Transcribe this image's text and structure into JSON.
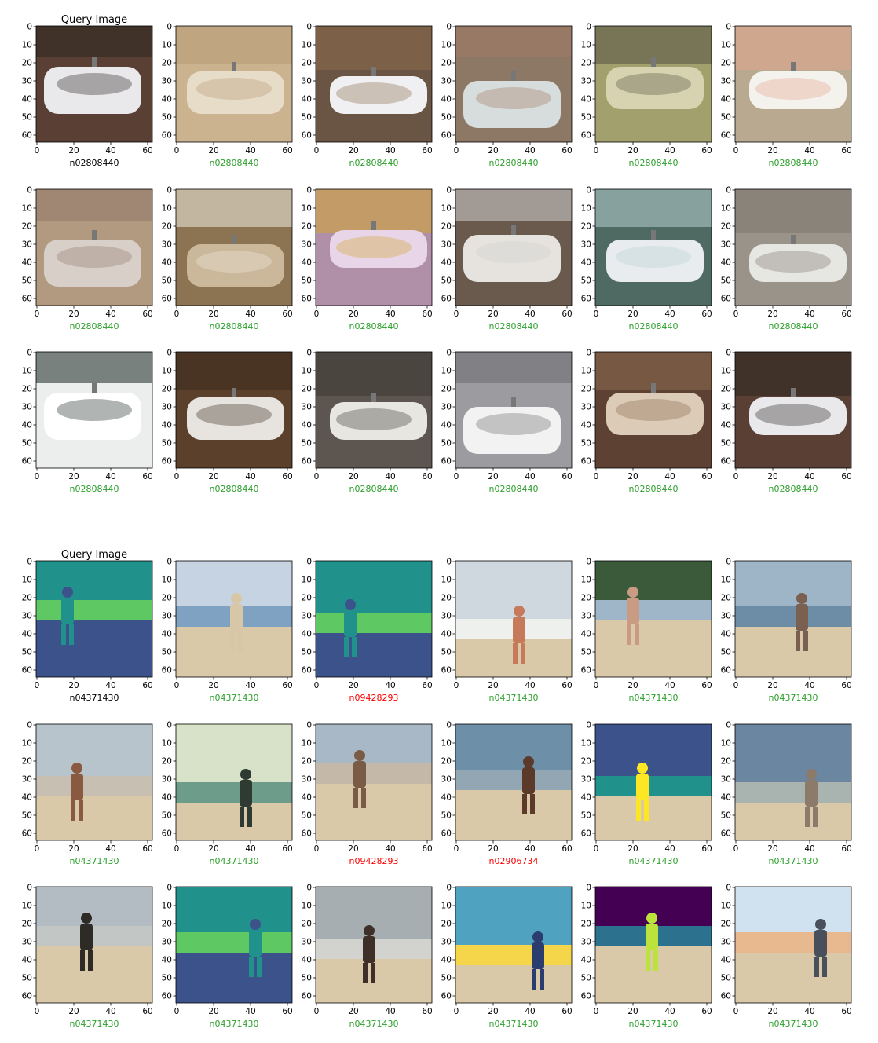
{
  "figure": {
    "query_title": "Query Image",
    "axis_ticks": [
      "0",
      "10",
      "20",
      "30",
      "40",
      "50",
      "60"
    ],
    "x_ticks": [
      "0",
      "20",
      "40",
      "60"
    ],
    "colors": {
      "query": "#000000",
      "correct": "#2ca02c",
      "wrong": "#ff0000"
    }
  },
  "chart_data": [
    {
      "type": "table",
      "title": "Query Image",
      "query_label": "n02808440",
      "scene": "bathtub",
      "xlim": [
        0,
        63
      ],
      "ylim": [
        63,
        0
      ],
      "results": [
        [
          "n02808440",
          "correct",
          "tub-beige"
        ],
        [
          "n02808440",
          "correct",
          "tub-white"
        ],
        [
          "n02808440",
          "correct",
          "tub-person"
        ],
        [
          "n02808440",
          "correct",
          "tub-olive"
        ],
        [
          "n02808440",
          "correct",
          "tub-legs"
        ],
        [
          "n02808440",
          "correct",
          "tub-tile"
        ],
        [
          "n02808440",
          "correct",
          "tub-corner"
        ],
        [
          "n02808440",
          "correct",
          "tub-gold"
        ],
        [
          "n02808440",
          "correct",
          "tub-clawfoot"
        ],
        [
          "n02808440",
          "correct",
          "tub-window"
        ],
        [
          "n02808440",
          "correct",
          "tub-grey"
        ],
        [
          "n02808440",
          "correct",
          "tub-product"
        ],
        [
          "n02808440",
          "correct",
          "tub-wood"
        ],
        [
          "n02808440",
          "correct",
          "tub-stone"
        ],
        [
          "n02808440",
          "correct",
          "tub-blue-wall"
        ],
        [
          "n02808440",
          "correct",
          "tub-faucet"
        ],
        [
          "n02808440",
          "correct",
          "tub-brown"
        ]
      ]
    },
    {
      "type": "table",
      "title": "Query Image",
      "query_label": "n04371430",
      "scene": "beach",
      "xlim": [
        0,
        63
      ],
      "ylim": [
        63,
        0
      ],
      "results": [
        [
          "n04371430",
          "correct",
          "sunset"
        ],
        [
          "n09428293",
          "wrong",
          "viridis-run"
        ],
        [
          "n04371430",
          "correct",
          "jump"
        ],
        [
          "n04371430",
          "correct",
          "sand-beach"
        ],
        [
          "n04371430",
          "correct",
          "night"
        ],
        [
          "n04371430",
          "correct",
          "pale-shore"
        ],
        [
          "n04371430",
          "correct",
          "pool"
        ],
        [
          "n09428293",
          "wrong",
          "sky-beach"
        ],
        [
          "n02906734",
          "wrong",
          "sand-kite"
        ],
        [
          "n04371430",
          "correct",
          "jump-sky"
        ],
        [
          "n04371430",
          "correct",
          "surf"
        ],
        [
          "n04371430",
          "correct",
          "man-sea"
        ],
        [
          "n04371430",
          "correct",
          "viridis-stand"
        ],
        [
          "n04371430",
          "correct",
          "waves"
        ],
        [
          "n04371430",
          "correct",
          "grey-sky"
        ],
        [
          "n04371430",
          "correct",
          "palm-beach"
        ],
        [
          "n04371430",
          "correct",
          "run-surf"
        ]
      ]
    }
  ]
}
